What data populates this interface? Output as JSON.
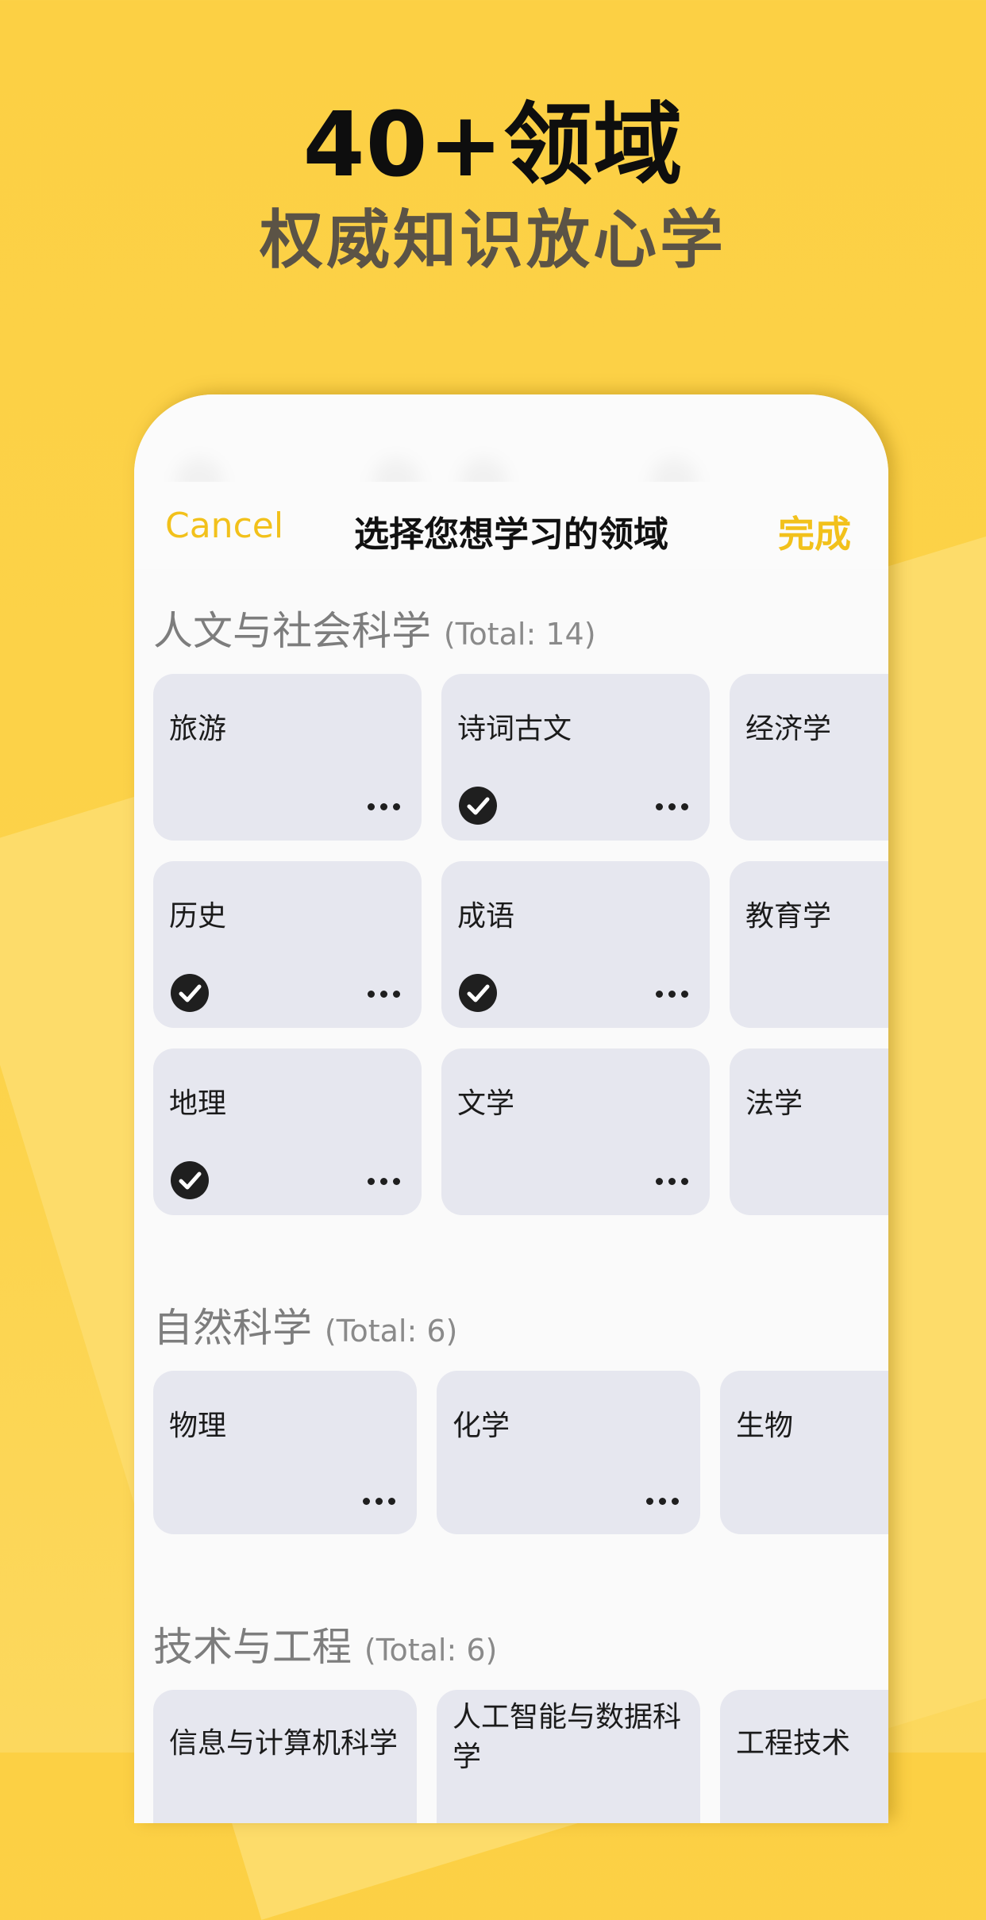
{
  "hero": {
    "title": "40+领域",
    "subtitle": "权威知识放心学"
  },
  "nav": {
    "cancel_label": "Cancel",
    "title": "选择您想学习的领域",
    "done_label": "完成"
  },
  "sections": [
    {
      "title": "人文与社会科学",
      "count": "(Total: 14)",
      "items": [
        {
          "label": "旅游",
          "checked": false,
          "more": true
        },
        {
          "label": "诗词古文",
          "checked": true,
          "more": true
        },
        {
          "label": "经济学",
          "checked": false,
          "more": false
        },
        {
          "label": "历史",
          "checked": true,
          "more": true
        },
        {
          "label": "成语",
          "checked": true,
          "more": true
        },
        {
          "label": "教育学",
          "checked": false,
          "more": false
        },
        {
          "label": "地理",
          "checked": true,
          "more": true
        },
        {
          "label": "文学",
          "checked": false,
          "more": true
        },
        {
          "label": "法学",
          "checked": false,
          "more": false
        }
      ]
    },
    {
      "title": "自然科学",
      "count": "(Total: 6)",
      "items": [
        {
          "label": "物理",
          "checked": false,
          "more": true
        },
        {
          "label": "化学",
          "checked": false,
          "more": true
        },
        {
          "label": "生物",
          "checked": false,
          "more": false
        }
      ]
    },
    {
      "title": "技术与工程",
      "count": "(Total: 6)",
      "items": [
        {
          "label": "信息与计算机科学",
          "checked": false,
          "more": false
        },
        {
          "label": "人工智能与数据科学",
          "checked": false,
          "more": false
        },
        {
          "label": "工程技术",
          "checked": false,
          "more": false
        }
      ]
    }
  ],
  "colors": {
    "accent": "#f2c11b",
    "background": "#fcd044",
    "card": "#e6e7ef"
  }
}
